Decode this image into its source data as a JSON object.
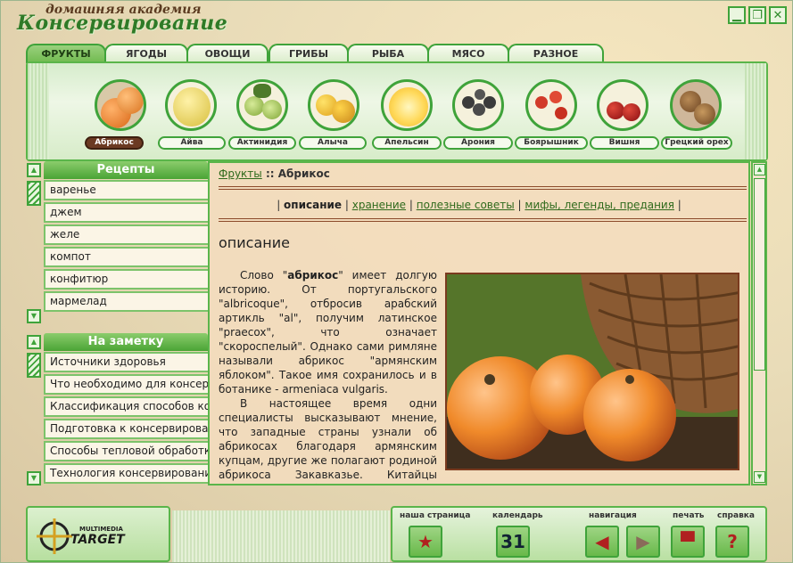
{
  "app": {
    "title_top": "домашняя академия",
    "title_main": "Консервирование"
  },
  "window_buttons": [
    "minimize",
    "maximize",
    "close"
  ],
  "tabs": [
    {
      "label": "ФРУКТЫ",
      "active": true
    },
    {
      "label": "ЯГОДЫ",
      "active": false
    },
    {
      "label": "ОВОЩИ",
      "active": false
    },
    {
      "label": "ГРИБЫ",
      "active": false
    },
    {
      "label": "РЫБА",
      "active": false
    },
    {
      "label": "МЯСО",
      "active": false
    },
    {
      "label": "РАЗНОЕ",
      "active": false
    }
  ],
  "fruits": [
    {
      "label": "Абрикос",
      "active": true
    },
    {
      "label": "Айва",
      "active": false
    },
    {
      "label": "Актинидия",
      "active": false
    },
    {
      "label": "Алыча",
      "active": false
    },
    {
      "label": "Апельсин",
      "active": false
    },
    {
      "label": "Арония",
      "active": false
    },
    {
      "label": "Боярышник",
      "active": false
    },
    {
      "label": "Вишня",
      "active": false
    },
    {
      "label": "Грецкий орех",
      "active": false
    }
  ],
  "recipes": {
    "title": "Рецепты",
    "items": [
      "варенье",
      "джем",
      "желе",
      "компот",
      "конфитюр",
      "мармелад"
    ]
  },
  "notes": {
    "title": "На заметку",
    "items": [
      "Источники здоровья",
      "Что необходимо для консервирования",
      "Классификация способов консервирования",
      "Подготовка к консервированию",
      "Способы тепловой обработки",
      "Технология консервирования"
    ]
  },
  "breadcrumb": {
    "link": "Фрукты",
    "separator": "::",
    "current": "Абрикос"
  },
  "subnav": {
    "active": "описание",
    "links": [
      "хранение",
      "полезные советы",
      "мифы, легенды, предания"
    ]
  },
  "section_title": "описание",
  "article": {
    "p1_prefix": "Слово \"",
    "p1_bold": "абрикос",
    "p1_rest": "\" имеет долгую историю. От португальского \"albricoque\", отбросив арабский артикль \"al\", получим латинское \"praecox\", что означает \"скороспелый\". Однако сами римляне называли абрикос \"армянским яблоком\". Такое имя сохранилось и в ботанике - armeniaca vulgaris.",
    "p2": "В настоящее время одни специалисты высказывают мнение, что западные страны узнали об абрикосах благодаря армянским купцам, другие же полагают родиной абрикоса Закавказье. Китайцы выращивают абрикосовые деревья ради ароматных плодов свыше"
  },
  "footer": {
    "logo_small": "MULTIMEDIA",
    "logo_main": "TARGET",
    "buttons": [
      {
        "label": "наша страница",
        "icon": "star-icon",
        "glyph": "★"
      },
      {
        "label": "календарь",
        "icon": "calendar-icon",
        "glyph": "31"
      },
      {
        "label": "навигация",
        "icon": "back-arrow-icon",
        "glyph": "◀"
      },
      {
        "label": "печать",
        "icon": "print-icon",
        "glyph": "▀"
      },
      {
        "label": "справка",
        "icon": "help-icon",
        "glyph": "?"
      }
    ]
  },
  "colors": {
    "accent_green": "#3fa33a",
    "active_fruit": "#6b3a22",
    "link": "#2f6a1c"
  }
}
